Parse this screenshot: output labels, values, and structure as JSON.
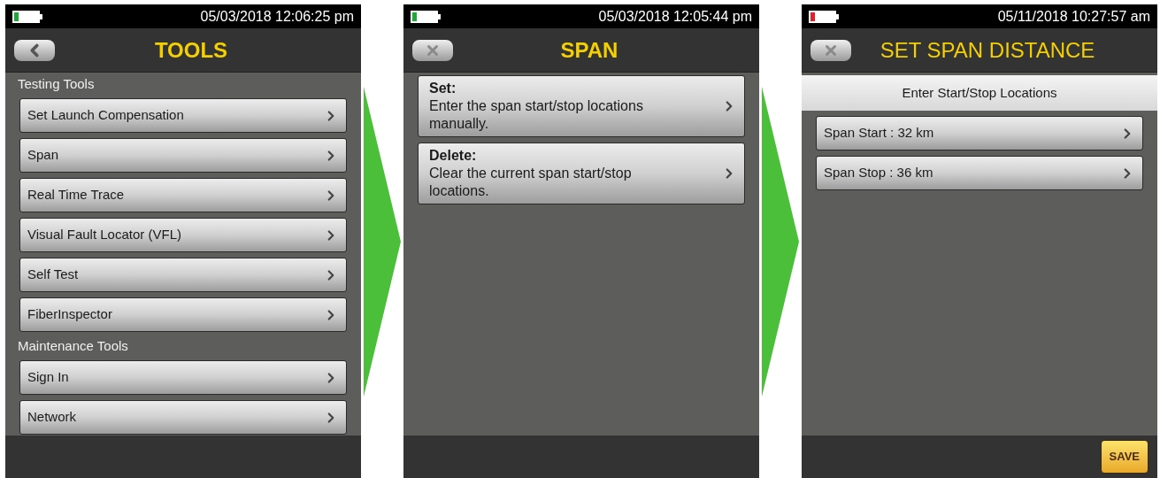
{
  "screens": [
    {
      "battery": {
        "color": "#1fa83a"
      },
      "datetime": "05/03/2018 12:06:25 pm",
      "nav_button": {
        "kind": "back"
      },
      "title": {
        "text": "TOOLS",
        "bold": true
      },
      "content": [
        {
          "kind": "heading",
          "label": "Testing Tools"
        },
        {
          "kind": "item",
          "label": "Set Launch Compensation"
        },
        {
          "kind": "item",
          "label": "Span"
        },
        {
          "kind": "item",
          "label": "Real Time Trace"
        },
        {
          "kind": "item",
          "label": "Visual Fault Locator (VFL)"
        },
        {
          "kind": "item",
          "label": "Self Test"
        },
        {
          "kind": "item",
          "label": "FiberInspector"
        },
        {
          "kind": "heading",
          "label": "Maintenance Tools"
        },
        {
          "kind": "item",
          "label": "Sign In"
        },
        {
          "kind": "item",
          "label": "Network"
        }
      ]
    },
    {
      "battery": {
        "color": "#1fa83a"
      },
      "datetime": "05/03/2018 12:05:44 pm",
      "nav_button": {
        "kind": "close"
      },
      "title": {
        "text": "SPAN",
        "bold": true
      },
      "content": [
        {
          "kind": "option",
          "label": "Set:",
          "description": "Enter the span start/stop locations manually."
        },
        {
          "kind": "option",
          "label": "Delete:",
          "description": "Clear the current span start/stop locations."
        }
      ]
    },
    {
      "battery": {
        "color": "#e0202a"
      },
      "datetime": "05/11/2018 10:27:57 am",
      "nav_button": {
        "kind": "close"
      },
      "title": {
        "text": "SET SPAN DISTANCE",
        "bold": false
      },
      "content": [
        {
          "kind": "banner",
          "label": "Enter Start/Stop Locations"
        },
        {
          "kind": "item",
          "label": "Span Start : 32 km"
        },
        {
          "kind": "item",
          "label": "Span Stop : 36 km"
        }
      ],
      "save_button": "SAVE"
    }
  ]
}
